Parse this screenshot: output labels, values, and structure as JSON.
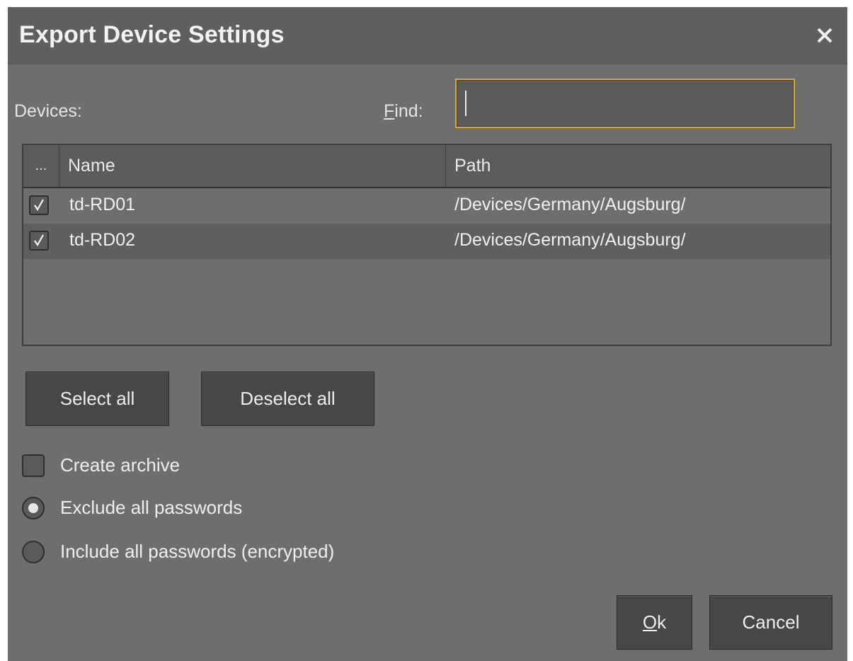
{
  "dialog": {
    "title": "Export Device Settings",
    "close_icon": "close-icon"
  },
  "devices_label": "Devices:",
  "find": {
    "label_mnemonic": "F",
    "label_rest": "ind:",
    "value": "",
    "placeholder": ""
  },
  "table": {
    "columns": [
      "...",
      "Name",
      "Path"
    ],
    "rows": [
      {
        "checked": true,
        "name": "td-RD01",
        "path": "/Devices/Germany/Augsburg/"
      },
      {
        "checked": true,
        "name": "td-RD02",
        "path": "/Devices/Germany/Augsburg/"
      }
    ]
  },
  "buttons": {
    "select_all": "Select all",
    "deselect_all": "Deselect all",
    "ok_mnemonic": "O",
    "ok_rest": "k",
    "cancel": "Cancel"
  },
  "options": {
    "create_archive": {
      "label": "Create archive",
      "checked": false
    },
    "exclude_passwords": {
      "label": "Exclude all passwords",
      "selected": true
    },
    "include_passwords": {
      "label": "Include all passwords (encrypted)",
      "selected": false
    }
  },
  "colors": {
    "background": "#6e6e6e",
    "titlebar": "#5f5f5f",
    "focus_border": "#e0a828",
    "button": "#474747"
  }
}
